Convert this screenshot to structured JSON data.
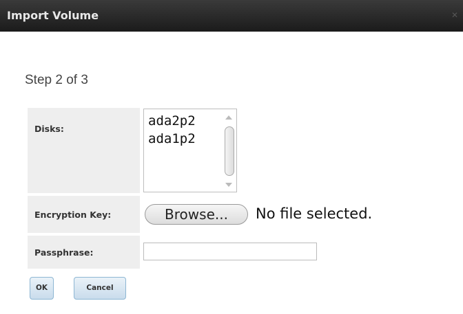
{
  "dialog": {
    "title": "Import Volume",
    "close_icon": "close-icon"
  },
  "step_text": "Step 2 of 3",
  "fields": {
    "disks": {
      "label": "Disks:",
      "options": [
        "ada2p2",
        "ada1p2"
      ]
    },
    "encryption_key": {
      "label": "Encryption Key:",
      "browse_label": "Browse...",
      "status": "No file selected."
    },
    "passphrase": {
      "label": "Passphrase:",
      "value": ""
    }
  },
  "buttons": {
    "ok": "OK",
    "cancel": "Cancel"
  },
  "colors": {
    "titlebar": "#252525",
    "label_bg": "#eeeeee",
    "button_border": "#8db6d3"
  }
}
